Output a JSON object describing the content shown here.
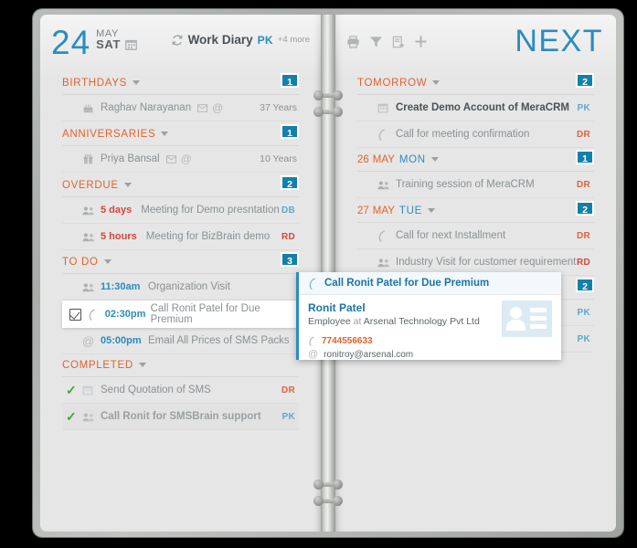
{
  "left_page": {
    "date": {
      "day": "24",
      "month": "MAY",
      "weekday": "SAT",
      "calendar_icon": "calendar-icon"
    },
    "diary": {
      "sync_icon": "sync-icon",
      "label": "Work Diary",
      "owner": "PK",
      "more": "+4 more"
    },
    "sections": [
      {
        "title": "BIRTHDAYS",
        "badge": "1",
        "rows": [
          {
            "icon": "cake-icon",
            "text": "Raghav Narayanan",
            "extra_icons": "envelope-icon at-icon",
            "right": "37 Years"
          }
        ]
      },
      {
        "title": "ANNIVERSARIES",
        "badge": "1",
        "rows": [
          {
            "icon": "gift-icon",
            "text": "Priya Bansal",
            "extra_icons": "envelope-icon at-icon",
            "right": "10 Years"
          }
        ]
      },
      {
        "title": "OVERDUE",
        "badge": "2",
        "rows": [
          {
            "icon": "people-icon",
            "time": "5 days",
            "text": "Meeting for Demo presntation",
            "initials": "DB"
          },
          {
            "icon": "people-icon",
            "time": "5 hours",
            "text": "Meeting for BizBrain demo",
            "initials": "RD"
          }
        ]
      },
      {
        "title": "TO DO",
        "badge": "3",
        "rows": [
          {
            "icon": "people-icon",
            "time": "11:30am",
            "text": "Organization Visit",
            "initials": ""
          },
          {
            "icon": "phone-icon",
            "time": "02:30pm",
            "text": "Call Ronit Patel for Due Premium",
            "selected": true,
            "checkbox_icon": "checkbox-checked-icon"
          },
          {
            "icon": "at-icon",
            "time": "05:00pm",
            "text": "Email All Prices of SMS Packs",
            "initials": ""
          }
        ]
      },
      {
        "title": "COMPLETED",
        "badge": "",
        "rows": [
          {
            "icon": "calendar-icon",
            "check_icon": "check-icon",
            "text": "Send Quotation of SMS",
            "initials": "DR"
          },
          {
            "icon": "people-icon",
            "check_icon": "check-icon",
            "text": "Call Ronit for SMSBrain support",
            "initials": "PK"
          }
        ]
      }
    ]
  },
  "right_page": {
    "title": "NEXT",
    "toolbar": [
      {
        "name": "print-icon"
      },
      {
        "name": "filter-icon"
      },
      {
        "name": "export-note-icon"
      },
      {
        "name": "add-icon"
      }
    ],
    "sections": [
      {
        "title": "TOMORROW",
        "badge": "2",
        "rows": [
          {
            "icon": "calendar-icon",
            "text": "Create Demo Account of MeraCRM",
            "initials": "PK",
            "bold": true
          },
          {
            "icon": "phone-icon",
            "text": "Call for meeting confirmation",
            "initials": "DR"
          }
        ]
      },
      {
        "date_day": "26",
        "date_month": "MAY",
        "title": "MON",
        "badge": "1",
        "rows": [
          {
            "icon": "people-icon",
            "text": "Training session of MeraCRM",
            "initials": "DR"
          }
        ]
      },
      {
        "date_day": "27",
        "date_month": "MAY",
        "title": "TUE",
        "badge": "2",
        "rows": [
          {
            "icon": "phone-icon",
            "text": "Call for next Installment",
            "initials": "DR"
          },
          {
            "icon": "people-icon",
            "text": "Industry Visit for customer requirement",
            "initials": "RD"
          }
        ]
      },
      {
        "title": "",
        "badge": "2",
        "rows": [
          {
            "icon": "",
            "text": "",
            "initials": "PK"
          },
          {
            "icon": "",
            "text": "",
            "initials": "PK"
          }
        ]
      }
    ]
  },
  "popup": {
    "header_icon": "phone-icon",
    "header_title": "Call Ronit Patel for Due Premium",
    "contact_name": "Ronit Patel",
    "role": "Employee",
    "at": "at",
    "company": "Arsenal Technology Pvt Ltd",
    "phone": "7744556633",
    "phone_icon": "phone-icon",
    "email": "ronitroy@arsenal.com",
    "email_icon": "at-icon",
    "avatar_icon": "contact-card-icon"
  },
  "colors": {
    "accent_blue": "#2a8cc0",
    "badge_blue": "#1380ab",
    "section_orange": "#e2622c",
    "overdue_red": "#d9453a",
    "done_green": "#3fa63f"
  }
}
